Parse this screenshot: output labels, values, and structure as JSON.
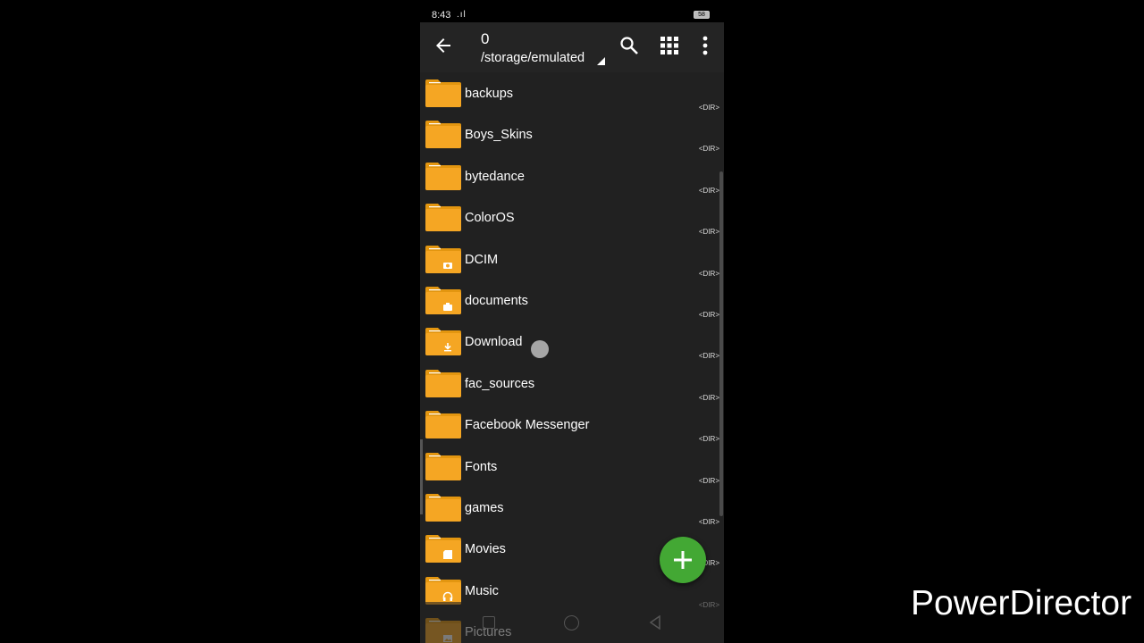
{
  "status": {
    "time": "8:43",
    "signal": ".ıl",
    "battery": "58"
  },
  "toolbar": {
    "title": "0",
    "path": "/storage/emulated"
  },
  "folders": [
    {
      "name": "backups",
      "tag": "<DIR>",
      "badge": ""
    },
    {
      "name": "Boys_Skins",
      "tag": "<DIR>",
      "badge": ""
    },
    {
      "name": "bytedance",
      "tag": "<DIR>",
      "badge": ""
    },
    {
      "name": "ColorOS",
      "tag": "<DIR>",
      "badge": ""
    },
    {
      "name": "DCIM",
      "tag": "<DIR>",
      "badge": "camera"
    },
    {
      "name": "documents",
      "tag": "<DIR>",
      "badge": "briefcase"
    },
    {
      "name": "Download",
      "tag": "<DIR>",
      "badge": "download"
    },
    {
      "name": "fac_sources",
      "tag": "<DIR>",
      "badge": ""
    },
    {
      "name": "Facebook Messenger",
      "tag": "<DIR>",
      "badge": ""
    },
    {
      "name": "Fonts",
      "tag": "<DIR>",
      "badge": ""
    },
    {
      "name": "games",
      "tag": "<DIR>",
      "badge": ""
    },
    {
      "name": "Movies",
      "tag": "<DIR>",
      "badge": "clapper"
    },
    {
      "name": "Music",
      "tag": "<DIR>",
      "badge": "headphones"
    },
    {
      "name": "Pictures",
      "tag": "",
      "badge": "image"
    }
  ],
  "fab_icon": "plus-icon",
  "watermark": "PowerDirector",
  "colors": {
    "folder": "#f5a623",
    "folder_tab": "#e39610",
    "fab": "#43a834",
    "background": "#212121"
  }
}
